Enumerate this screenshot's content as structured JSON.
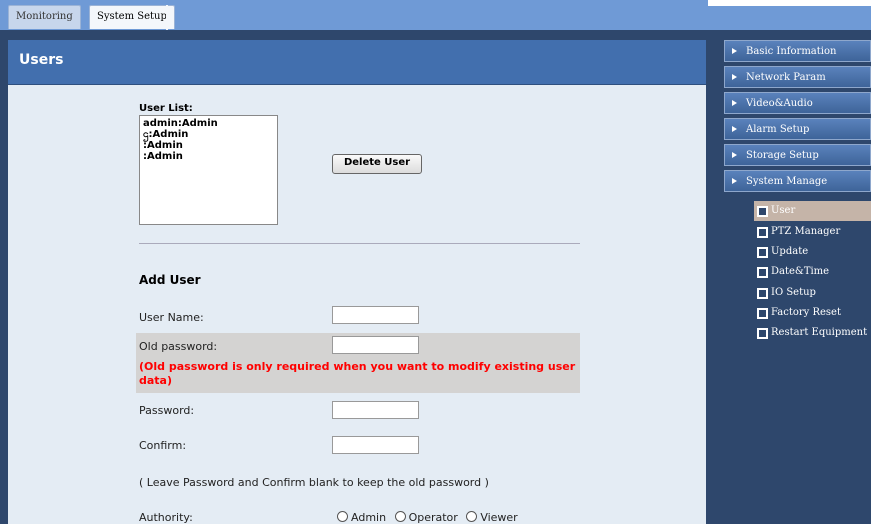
{
  "tabs": [
    {
      "label": "Monitoring"
    },
    {
      "label": "System Setup"
    }
  ],
  "page": {
    "title": "Users"
  },
  "userlist": {
    "label": "User List:",
    "items": [
      "admin:Admin",
      "ဌ:Admin",
      ":Admin",
      ":Admin"
    ]
  },
  "buttons": {
    "delete_user": "Delete User"
  },
  "form": {
    "section_title": "Add User",
    "username_label": "User Name:",
    "old_password_label": "Old password:",
    "old_password_note": "(Old password is only required when you want to modify existing user data)",
    "password_label": "Password:",
    "confirm_label": "Confirm:",
    "password_hint": "( Leave Password and Confirm blank to keep the old password )",
    "authority_label": "Authority:",
    "authority_options": [
      "Admin",
      "Operator",
      "Viewer"
    ]
  },
  "sidebar": {
    "menu": [
      "Basic Information",
      "Network Param",
      "Video&Audio",
      "Alarm Setup",
      "Storage Setup",
      "System Manage"
    ],
    "submenu": [
      "User",
      "PTZ Manager",
      "Update",
      "Date&Time",
      "IO Setup",
      "Factory Reset",
      "Restart Equipment"
    ],
    "active_submenu": "User"
  },
  "colors": {
    "header": "#426fae",
    "content_bg": "#e4ecf4",
    "frame": "#2e476c",
    "warning": "#ff0000",
    "active_sub": "#c5b4a8"
  }
}
